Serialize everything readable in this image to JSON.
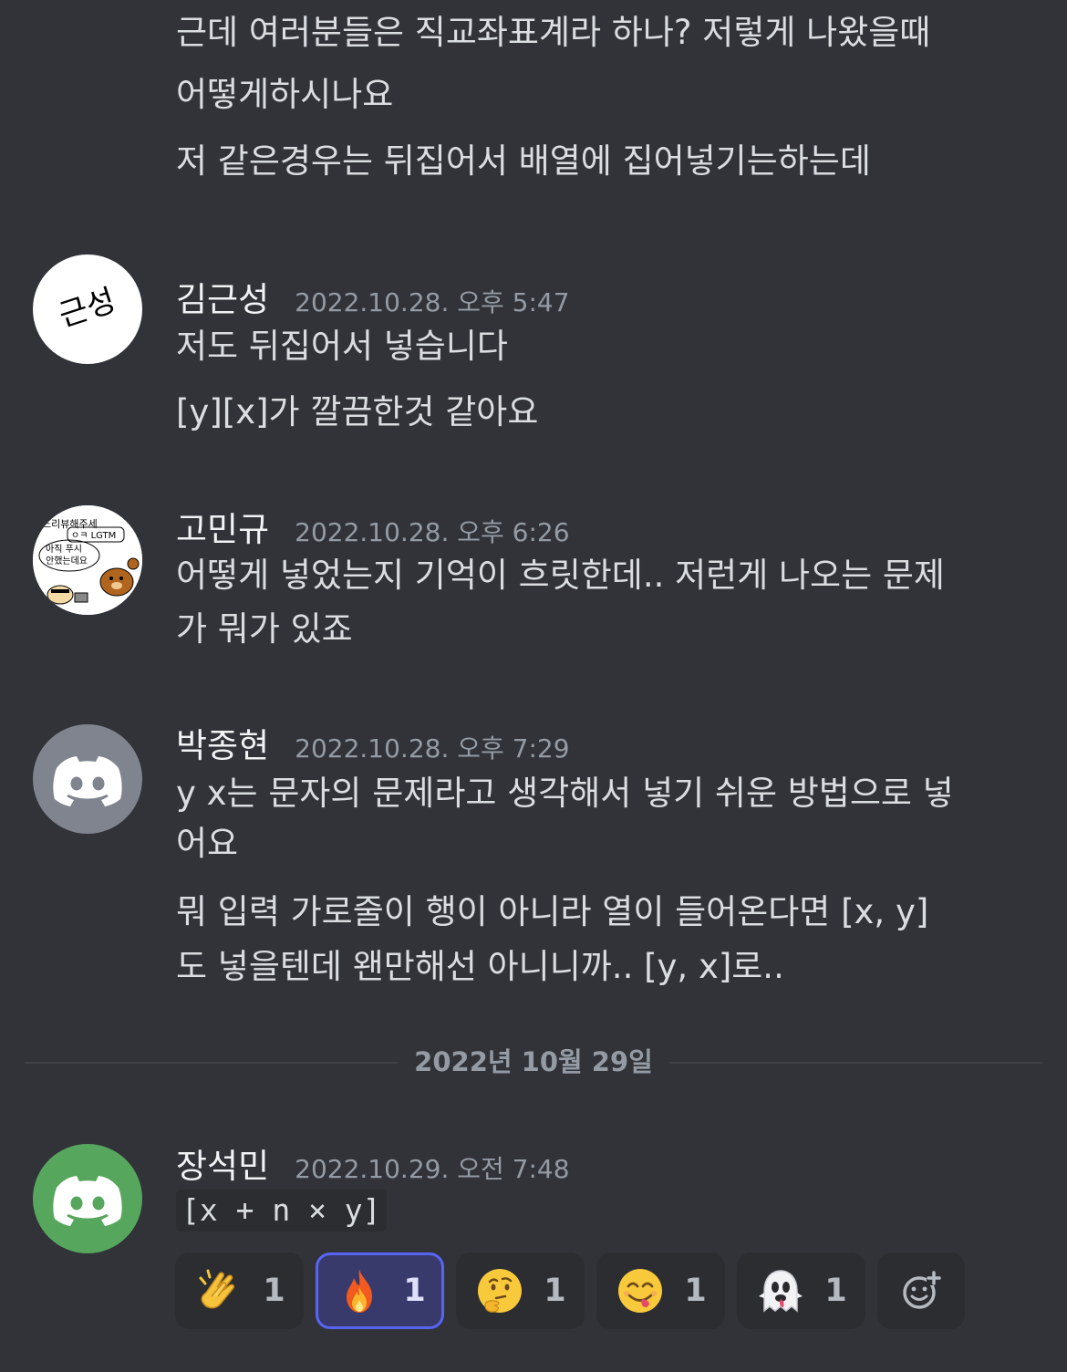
{
  "messages": [
    {
      "lines": [
        "근데 여러분들은 직교좌표계라 하나? 저렇게 나왔을때",
        "어떻게하시나요",
        "저 같은경우는 뒤집어서 배열에 집어넣기는하는데"
      ]
    },
    {
      "author": "김근성",
      "timestamp": "2022.10.28. 오후 5:47",
      "avatar_text": "근성",
      "lines": [
        "저도 뒤집어서 넣습니다",
        "[y][x]가 깔끔한것 같아요"
      ]
    },
    {
      "author": "고민규",
      "timestamp": "2022.10.28. 오후 6:26",
      "avatar_texts": [
        "느리뷰해주세",
        "ㅇㅋ LGTM",
        "아직 푸시",
        "안했는데요"
      ],
      "lines": [
        "어떻게 넣었는지 기억이 흐릿한데.. 저런게 나오는 문제",
        "가 뭐가 있죠"
      ]
    },
    {
      "author": "박종현",
      "timestamp": "2022.10.28. 오후 7:29",
      "avatar_color": "#80848e",
      "lines": [
        "y x는 문자의 문제라고 생각해서 넣기 쉬운 방법으로 넣",
        "어요",
        "뭐 입력 가로줄이 행이 아니라 열이 들어온다면 [x, y]",
        "도 넣을텐데 왠만해선 아니니까.. [y, x]로.."
      ]
    },
    {
      "author": "장석민",
      "timestamp": "2022.10.29. 오전 7:48",
      "avatar_color": "#57a65e",
      "code": "[x + n × y]"
    }
  ],
  "divider": "2022년 10월 29일",
  "reactions": [
    {
      "emoji": "clapping-hands",
      "count": "1",
      "active": false
    },
    {
      "emoji": "fire",
      "count": "1",
      "active": true
    },
    {
      "emoji": "thinking-face",
      "count": "1",
      "active": false
    },
    {
      "emoji": "yum-face",
      "count": "1",
      "active": false
    },
    {
      "emoji": "ghost",
      "count": "1",
      "active": false
    }
  ],
  "colors": {
    "background": "#313338",
    "text": "#dbdee1",
    "muted": "#949ba4",
    "blurple": "#5865f2"
  }
}
